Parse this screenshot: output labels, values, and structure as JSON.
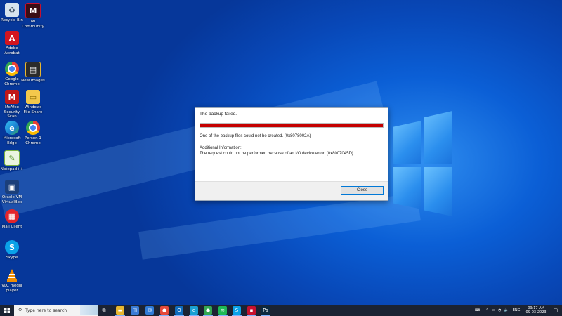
{
  "desktop": {
    "icons": [
      {
        "label": "Recycle Bin",
        "icon": "recycle-bin-icon",
        "color": "#d7e4ee"
      },
      {
        "label": "Mi Community",
        "icon": "app-icon",
        "color": "#c8102e"
      },
      {
        "label": "Adobe Acrobat",
        "icon": "pdf-icon",
        "color": "#d2151f"
      },
      {
        "label": "Google Chrome",
        "icon": "chrome-icon",
        "color": "#1a73e8"
      },
      {
        "label": "New Images",
        "icon": "folder-icon",
        "color": "#2b2b2b"
      },
      {
        "label": "McAfee Security Scan",
        "icon": "shield-icon",
        "color": "#c01818"
      },
      {
        "label": "Windows File Share",
        "icon": "folder-icon",
        "color": "#f3c84c"
      },
      {
        "label": "Microsoft Edge",
        "icon": "edge-icon",
        "color": "#18a0c8"
      },
      {
        "label": "Person 1 Chrome",
        "icon": "chrome-icon",
        "color": "#1a73e8"
      },
      {
        "label": "Notepad++",
        "icon": "notepad-icon",
        "color": "#7cb342"
      },
      {
        "label": "Oracle VM VirtualBox",
        "icon": "virtualbox-icon",
        "color": "#1b3f7a"
      },
      {
        "label": "Mail Client",
        "icon": "mail-icon",
        "color": "#e3242b"
      },
      {
        "label": "Skype",
        "icon": "skype-icon",
        "color": "#0aa2e8"
      },
      {
        "label": "VLC media player",
        "icon": "vlc-icon",
        "color": "#f08c00"
      }
    ]
  },
  "dialog": {
    "title": "The backup failed.",
    "progress": 1.0,
    "progress_color": "#c40000",
    "message": "One of the backup files could not be created. (0x8078002A)",
    "additional_label": "Additional Information:",
    "additional_text": "The request could not be performed because of an I/O device error. (0x8007045D)",
    "close_label": "Close"
  },
  "taskbar": {
    "search_placeholder": "Type here to search",
    "apps": [
      {
        "name": "task-view-icon",
        "glyph": "⧉",
        "color": "#1b2333"
      },
      {
        "name": "file-explorer-icon",
        "glyph": "▬",
        "color": "#e8b730"
      },
      {
        "name": "store-icon",
        "glyph": "◫",
        "color": "#3a7bd5"
      },
      {
        "name": "mail-icon",
        "glyph": "✉",
        "color": "#2f7bd8"
      },
      {
        "name": "chrome-icon",
        "glyph": "●",
        "color": "#e64a3b"
      },
      {
        "name": "outlook-icon",
        "glyph": "O",
        "color": "#0f6cbd"
      },
      {
        "name": "edge-icon",
        "glyph": "e",
        "color": "#1aa0d2"
      },
      {
        "name": "chrome-profile-icon",
        "glyph": "●",
        "color": "#34a853"
      },
      {
        "name": "spotify-icon",
        "glyph": "≋",
        "color": "#1db954"
      },
      {
        "name": "skype-icon",
        "glyph": "S",
        "color": "#0aa2e8"
      },
      {
        "name": "app-icon",
        "glyph": "▪",
        "color": "#c8102e"
      },
      {
        "name": "photoshop-icon",
        "glyph": "Ps",
        "color": "#0b2940"
      }
    ],
    "tray": {
      "language": "ENG",
      "time": "09:17 AM",
      "date": "09-03-2023"
    }
  }
}
